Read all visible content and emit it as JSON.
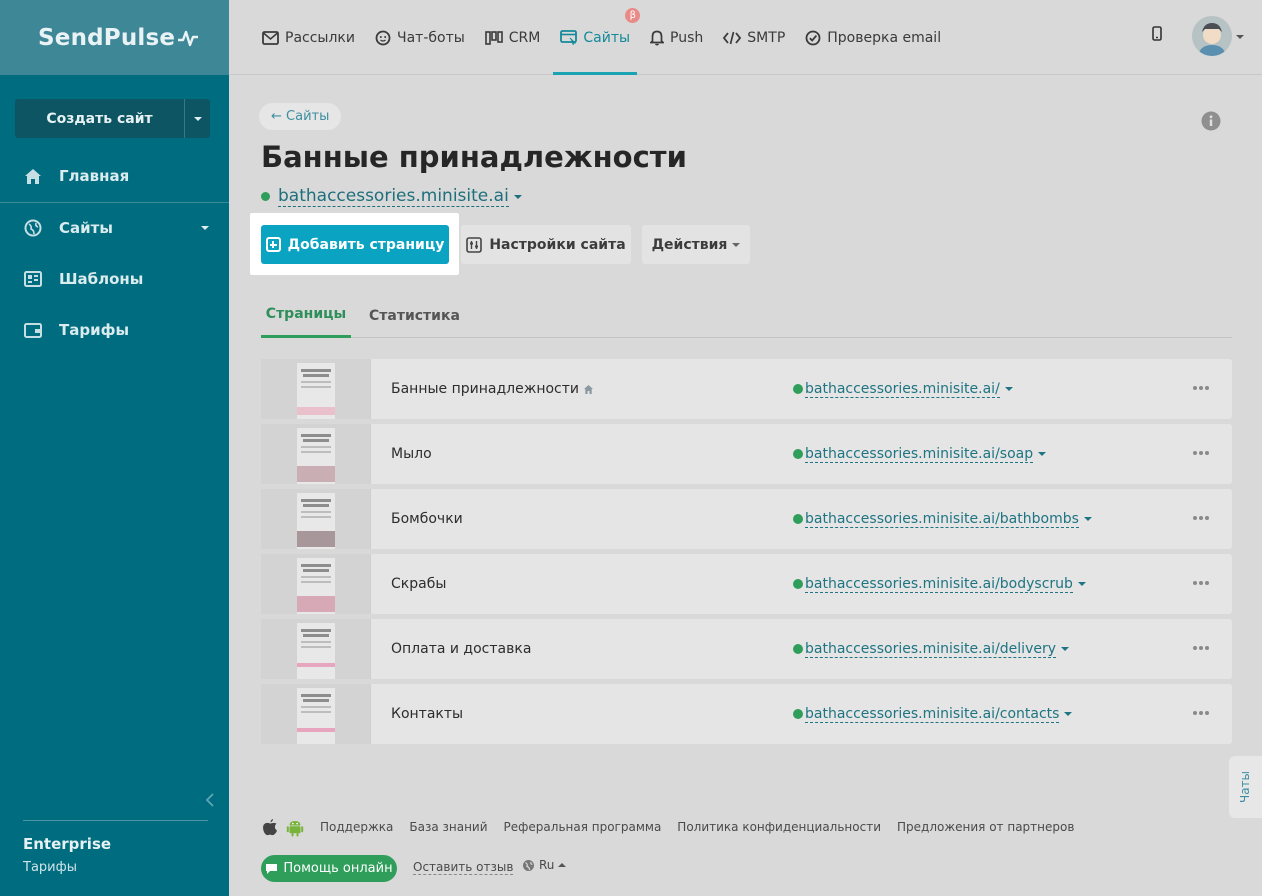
{
  "brand": {
    "logo_text": "SendPulse"
  },
  "sidebar": {
    "create_label": "Создать сайт",
    "items": [
      {
        "label": "Главная",
        "icon": "home-icon"
      },
      {
        "label": "Сайты",
        "icon": "globe-icon"
      },
      {
        "label": "Шаблоны",
        "icon": "templates-icon"
      },
      {
        "label": "Тарифы",
        "icon": "wallet-icon"
      }
    ],
    "plan_name": "Enterprise",
    "plan_link": "Тарифы"
  },
  "topnav": {
    "items": [
      {
        "label": "Рассылки",
        "icon": "mail-icon"
      },
      {
        "label": "Чат-боты",
        "icon": "chatbot-icon"
      },
      {
        "label": "CRM",
        "icon": "crm-icon"
      },
      {
        "label": "Сайты",
        "icon": "sites-icon",
        "active": true,
        "badge": "β"
      },
      {
        "label": "Push",
        "icon": "bell-icon"
      },
      {
        "label": "SMTP",
        "icon": "code-icon"
      },
      {
        "label": "Проверка email",
        "icon": "check-circle-icon"
      }
    ]
  },
  "main": {
    "back_label": "← Сайты",
    "title": "Банные принадлежности",
    "domain": "bathaccessories.minisite.ai",
    "buttons": {
      "add_page": "Добавить страницу",
      "settings": "Настройки сайта",
      "actions": "Действия"
    },
    "tabs": [
      {
        "label": "Страницы",
        "active": true
      },
      {
        "label": "Статистика",
        "active": false
      }
    ],
    "pages": [
      {
        "name": "Банные принадлежности",
        "url": "bathaccessories.minisite.ai/",
        "home": true
      },
      {
        "name": "Мыло",
        "url": "bathaccessories.minisite.ai/soap"
      },
      {
        "name": "Бомбочки",
        "url": "bathaccessories.minisite.ai/bathbombs"
      },
      {
        "name": "Скрабы",
        "url": "bathaccessories.minisite.ai/bodyscrub"
      },
      {
        "name": "Оплата и доставка",
        "url": "bathaccessories.minisite.ai/delivery"
      },
      {
        "name": "Контакты",
        "url": "bathaccessories.minisite.ai/contacts"
      }
    ]
  },
  "chat_tab": "Чаты",
  "footer": {
    "links": [
      "Поддержка",
      "База знаний",
      "Реферальная программа",
      "Политика конфиденциальности",
      "Предложения от партнеров"
    ],
    "help_label": "Помощь онлайн",
    "review_label": "Оставить отзыв",
    "language": "Ru"
  },
  "colors": {
    "sidebar": "#006c7f",
    "accent": "#0aa3c2",
    "success": "#2f9e5b"
  }
}
